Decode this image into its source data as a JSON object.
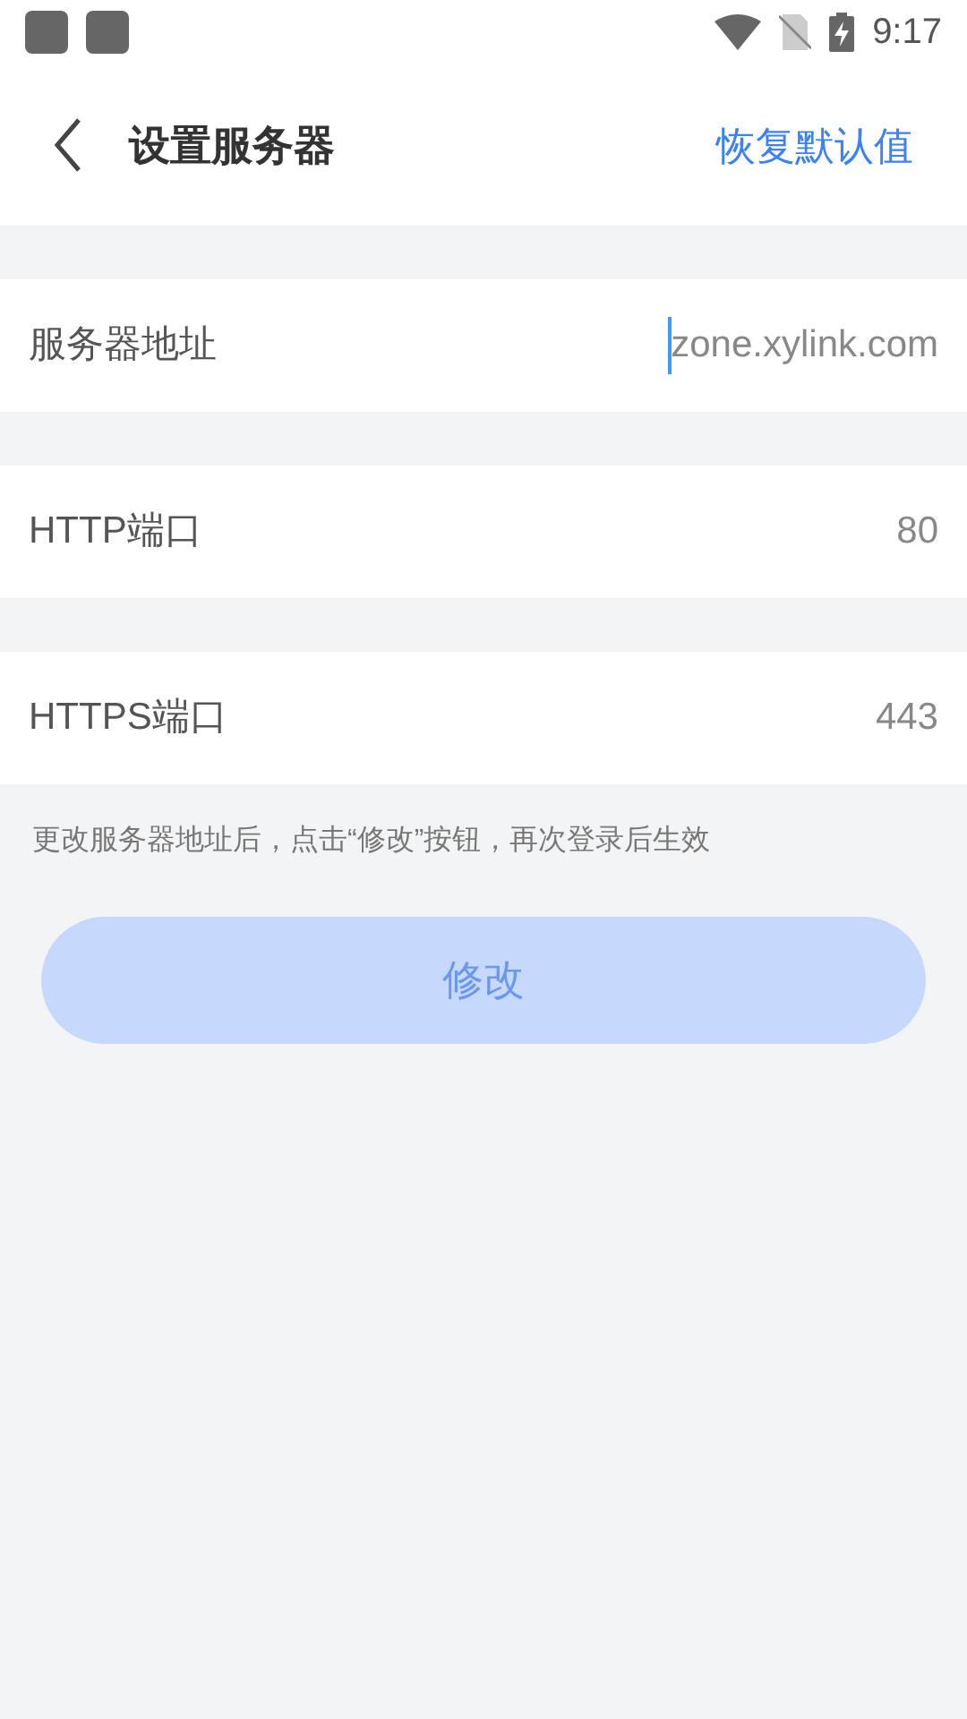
{
  "status_bar": {
    "time": "9:17"
  },
  "header": {
    "title": "设置服务器",
    "action": "恢复默认值"
  },
  "fields": [
    {
      "label": "服务器地址",
      "value": "zone.xylink.com",
      "focused": true
    },
    {
      "label": "HTTP端口",
      "value": "80",
      "focused": false
    },
    {
      "label": "HTTPS端口",
      "value": "443",
      "focused": false
    }
  ],
  "hint": "更改服务器地址后，点击“修改”按钮，再次登录后生效",
  "submit": {
    "label": "修改",
    "disabled": true
  }
}
